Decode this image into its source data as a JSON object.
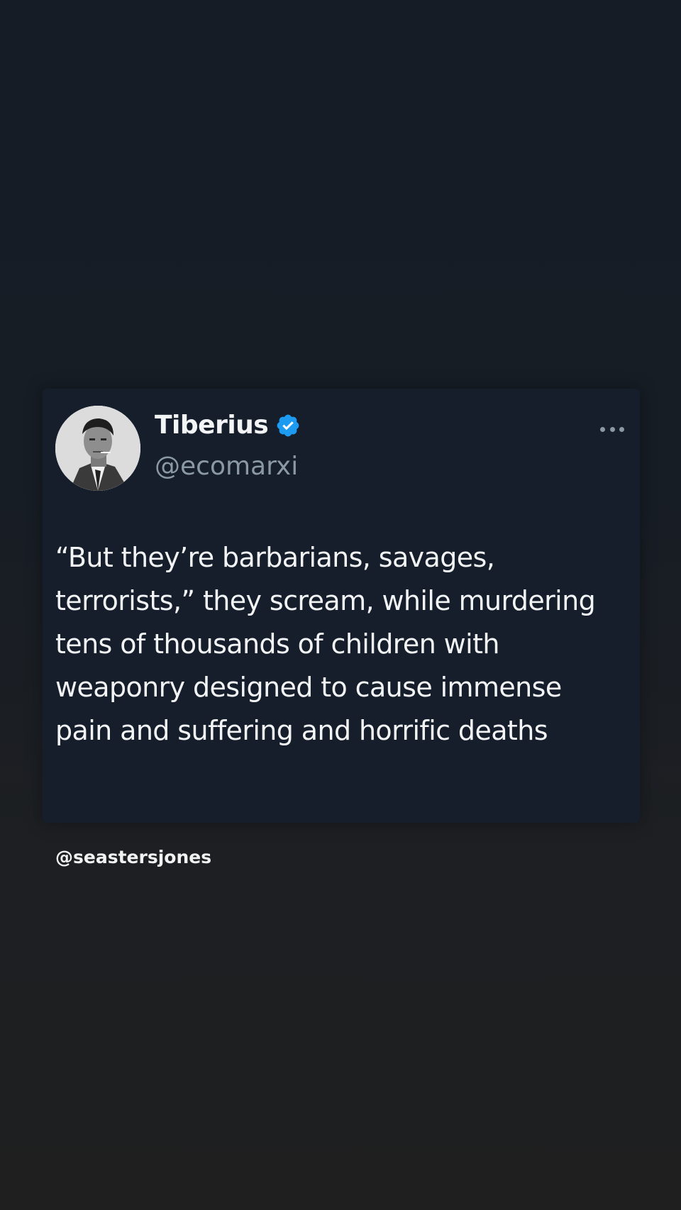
{
  "tweet": {
    "display_name": "Tiberius",
    "handle": "@ecomarxi",
    "verified": true,
    "verified_icon": "verified-badge-icon",
    "more_icon": "more-horizontal-icon",
    "text": "“But they’re barbarians, savages, terrorists,” they scream, while murdering tens of thousands of children with weaponry designed to cause immense pain and suffering and horrific deaths"
  },
  "credit": "@seastersjones",
  "colors": {
    "background_top": "#151c25",
    "background_bottom": "#1f1f20",
    "card": "#151e2a",
    "text_primary": "#f2f4f6",
    "text_secondary": "#8b98a5",
    "verified_blue": "#1d9bf0"
  }
}
